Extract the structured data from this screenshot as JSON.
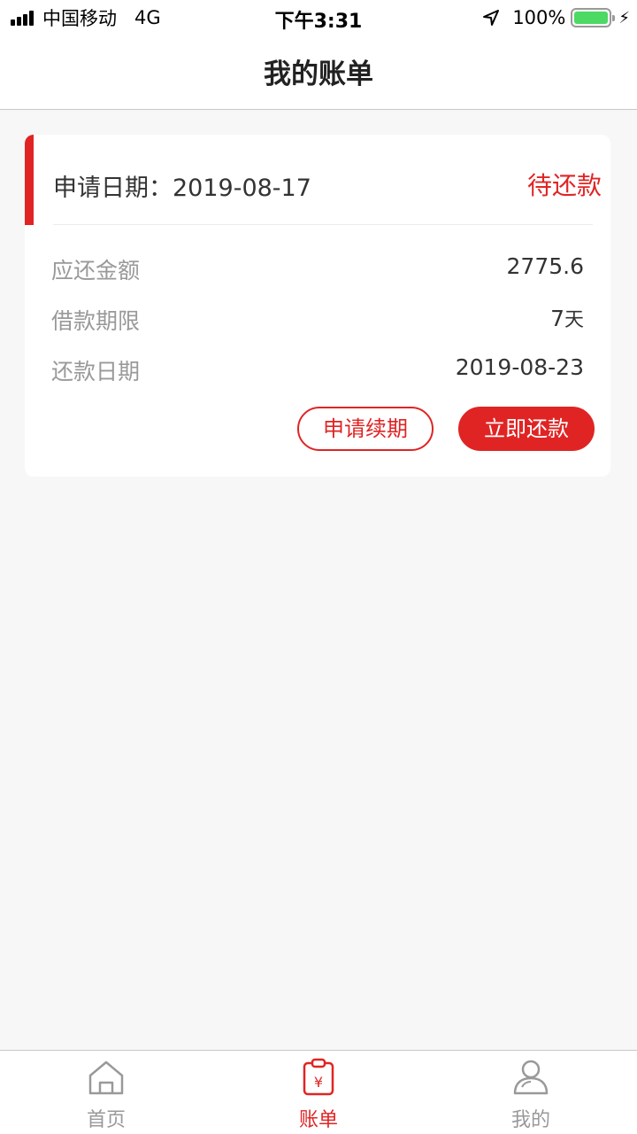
{
  "status_bar": {
    "carrier": "中国移动",
    "network": "4G",
    "time": "下午3:31",
    "battery": "100%",
    "battery_color": "#4cd964"
  },
  "header": {
    "title": "我的账单"
  },
  "bill": {
    "apply_date": "申请日期：2019-08-17",
    "status": "待还款",
    "rows": [
      {
        "label": "应还金额",
        "value": "2775.6",
        "unit": ""
      },
      {
        "label": "借款期限",
        "value": "7",
        "unit": "天"
      },
      {
        "label": "还款日期",
        "value": "2019-08-23",
        "unit": ""
      }
    ],
    "renew_label": "申请续期",
    "repay_label": "立即还款"
  },
  "tabbar": {
    "tabs": [
      {
        "label": "首页",
        "icon": "home-icon",
        "active": false
      },
      {
        "label": "账单",
        "icon": "bill-icon",
        "active": true
      },
      {
        "label": "我的",
        "icon": "user-icon",
        "active": false
      }
    ]
  },
  "colors": {
    "accent": "#e02424",
    "muted": "#999999",
    "background": "#f7f7f7"
  }
}
